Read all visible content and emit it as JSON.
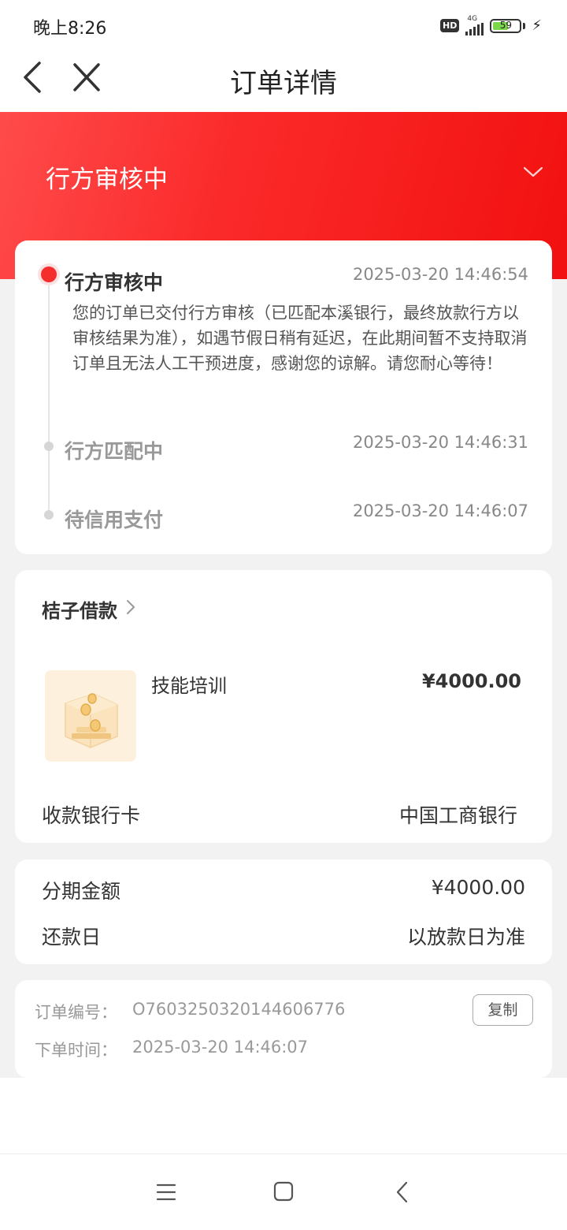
{
  "status": {
    "time": "晚上8:26",
    "hd": "HD",
    "network": "4G",
    "battery": "59",
    "battery_level": 0.59
  },
  "nav": {
    "title": "订单详情"
  },
  "hero": {
    "status": "行方审核中"
  },
  "timeline": [
    {
      "title": "行方审核中",
      "time": "2025-03-20 14:46:54",
      "active": true,
      "desc": "您的订单已交付行方审核（已匹配本溪银行，最终放款行方以审核结果为准），如遇节假日稍有延迟，在此期间暂不支持取消订单且无法人工干预进度，感谢您的谅解。请您耐心等待！"
    },
    {
      "title": "行方匹配中",
      "time": "2025-03-20 14:46:31",
      "active": false
    },
    {
      "title": "待信用支付",
      "time": "2025-03-20 14:46:07",
      "active": false
    }
  ],
  "loan": {
    "name": "桔子借款",
    "product": "技能培训",
    "price": "¥4000.00",
    "bank_label": "收款银行卡",
    "bank_value": "中国工商银行"
  },
  "installment": {
    "amount_label": "分期金额",
    "amount_value": "¥4000.00",
    "repay_label": "还款日",
    "repay_value": "以放款日为准"
  },
  "order": {
    "number_label": "订单编号：",
    "number_value": "O760325032014460677​6",
    "time_label": "下单时间：",
    "time_value": "2025-03-20 14:46:07",
    "copy_label": "复制"
  },
  "colors": {
    "accent": "#f42d2d",
    "background": "#f2f2f2"
  }
}
